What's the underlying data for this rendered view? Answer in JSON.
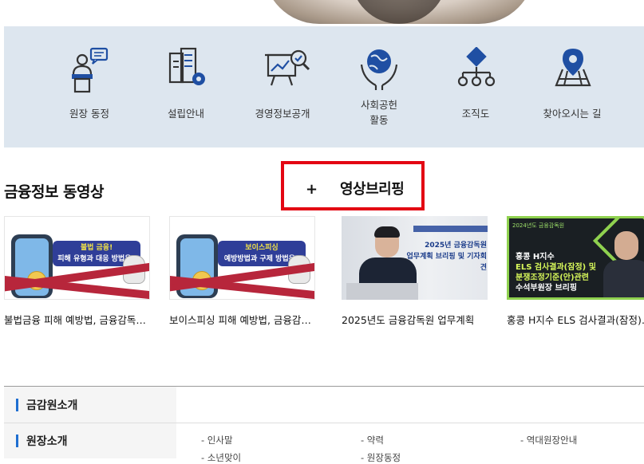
{
  "quick_menu": [
    {
      "label": "원장 동정",
      "icon": "speaker-podium-icon"
    },
    {
      "label": "설립안내",
      "icon": "building-gear-icon"
    },
    {
      "label": "경영정보공개",
      "icon": "presentation-magnifier-icon"
    },
    {
      "label": "사회공헌",
      "label2": "활동",
      "icon": "globe-hands-icon"
    },
    {
      "label": "조직도",
      "icon": "org-chart-icon"
    },
    {
      "label": "찾아오시는 길",
      "icon": "map-pin-icon"
    }
  ],
  "video_section": {
    "title": "금융정보 동영상",
    "briefing_plus": "+",
    "briefing_label": "영상브리핑",
    "videos": [
      {
        "caption": "불법금융 피해 예방법, 금융감독원이 알려드립니다",
        "thumb_lines": [
          "불법 금융!",
          "피해 유형과 대응 방법은?"
        ]
      },
      {
        "caption": "보이스피싱 피해 예방법, 금융감독원이 알려드립니다",
        "thumb_lines": [
          "보이스피싱",
          "예방방법과 구제 방법은?"
        ]
      },
      {
        "caption": "2025년도 금융감독원 업무계획",
        "thumb_lines": [
          "2025년 금융감독원",
          "업무계획 브리핑 및 기자회견"
        ]
      },
      {
        "caption": "홍콩 H지수 ELS 검사결과(잠정) 및 분쟁조정기준(안) 관련 수석부원장 브리핑",
        "thumb_lines": [
          "2024년도 금융감독원",
          "홍콩 H지수",
          "ELS 검사결과(잠정) 및",
          "분쟁조정기준(안)관련",
          "수석부원장 브리핑"
        ]
      }
    ]
  },
  "sitemap": {
    "section1": "금감원소개",
    "section2": "원장소개",
    "links_row1": [
      "- 인사말",
      "- 약력",
      "- 역대원장안내"
    ],
    "links_row2": [
      "- 소년맞이",
      "- 원장동정"
    ]
  },
  "colors": {
    "accent_red": "#e30613",
    "quick_bg": "#dde6ef",
    "icon_blue": "#1f4fa3"
  }
}
